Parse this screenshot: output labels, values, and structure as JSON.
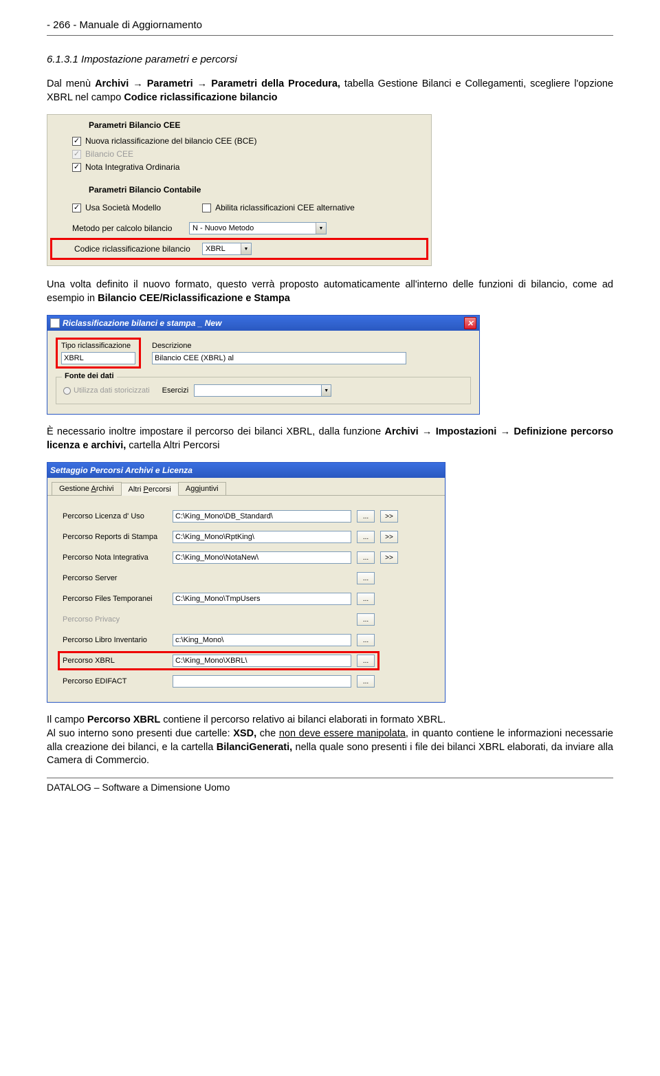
{
  "page_header": "- 266 -  Manuale di Aggiornamento",
  "section_number": "6.1.3.1  Impostazione parametri e percorsi",
  "para1_pre": "Dal menù ",
  "para1_b1": "Archivi",
  "para1_arr1": " → ",
  "para1_b2": "Parametri",
  "para1_arr2": " → ",
  "para1_b3": "Parametri della Procedura,",
  "para1_mid": " tabella Gestione Bilanci e Collegamenti, scegliere l'opzione XBRL nel campo ",
  "para1_b4": "Codice riclassificazione bilancio",
  "panel1": {
    "title1": "Parametri Bilancio CEE",
    "chk1": "Nuova riclassificazione del bilancio CEE (BCE)",
    "chk2": "Bilancio CEE",
    "chk3": "Nota Integrativa Ordinaria",
    "title2": "Parametri Bilancio Contabile",
    "chk4": "Usa Società Modello",
    "chk5": "Abilita riclassificazioni CEE alternative",
    "lbl_metodo": "Metodo per calcolo bilancio",
    "val_metodo": "N - Nuovo Metodo",
    "lbl_codice": "Codice riclassificazione bilancio",
    "val_codice": "XBRL"
  },
  "para2_pre": "Una volta definito il nuovo formato, questo verrà proposto automaticamente all'interno delle funzioni di bilancio, come ad esempio in ",
  "para2_b1": "Bilancio CEE/Riclassificazione e Stampa",
  "win1": {
    "title": "Riclassificazione bilanci e stampa _ New",
    "lbl_tipo": "Tipo riclassificazione",
    "val_tipo": "XBRL",
    "lbl_desc": "Descrizione",
    "val_desc": "Bilancio CEE (XBRL) al",
    "group_title": "Fonte dei dati",
    "radio1": "Utilizza dati storicizzati",
    "lbl_ese": "Esercizi"
  },
  "para3_pre": "È necessario inoltre impostare il percorso dei bilanci XBRL, dalla funzione ",
  "para3_b1": "Archivi",
  "para3_arr1": " → ",
  "para3_b2": "Impostazioni",
  "para3_arr2": " → ",
  "para3_b3": "Definizione percorso licenza e archivi,",
  "para3_post": " cartella Altri Percorsi",
  "win2": {
    "title": "Settaggio Percorsi Archivi e Licenza",
    "tab1a": "Gestione ",
    "tab1u": "A",
    "tab1b": "rchivi",
    "tab2a": "Altri ",
    "tab2u": "P",
    "tab2b": "ercorsi",
    "tab3a": "Agg",
    "tab3u": "i",
    "tab3b": "untivi",
    "rows": [
      {
        "label": "Percorso Licenza d' Uso",
        "value": "C:\\King_Mono\\DB_Standard\\",
        "btns": 2,
        "disabled": false,
        "hl": false,
        "hasInput": true
      },
      {
        "label": "Percorso Reports di Stampa",
        "value": "C:\\King_Mono\\RptKing\\",
        "btns": 2,
        "disabled": false,
        "hl": false,
        "hasInput": true
      },
      {
        "label": "Percorso Nota Integrativa",
        "value": "C:\\King_Mono\\NotaNew\\",
        "btns": 2,
        "disabled": false,
        "hl": false,
        "hasInput": true
      },
      {
        "label": "Percorso Server",
        "value": "",
        "btns": 1,
        "disabled": false,
        "hl": false,
        "hasInput": false
      },
      {
        "label": "Percorso Files Temporanei",
        "value": "C:\\King_Mono\\TmpUsers",
        "btns": 1,
        "disabled": false,
        "hl": false,
        "hasInput": true
      },
      {
        "label": "Percorso Privacy",
        "value": "",
        "btns": 1,
        "disabled": true,
        "hl": false,
        "hasInput": false
      },
      {
        "label": "Percorso Libro Inventario",
        "value": "c:\\King_Mono\\",
        "btns": 1,
        "disabled": false,
        "hl": false,
        "hasInput": true
      },
      {
        "label": "Percorso XBRL",
        "value": "C:\\King_Mono\\XBRL\\",
        "btns": 1,
        "disabled": false,
        "hl": true,
        "hasInput": true
      },
      {
        "label": "Percorso EDIFACT",
        "value": "",
        "btns": 1,
        "disabled": false,
        "hl": false,
        "hasInput": true
      }
    ],
    "btn_browse": "...",
    "btn_more": ">>"
  },
  "para4_a": "Il campo ",
  "para4_b1": "Percorso XBRL",
  "para4_b": "  contiene il percorso relativo ai bilanci elaborati in formato XBRL.",
  "para5_a": "Al suo interno sono presenti due cartelle: ",
  "para5_b1": "XSD,",
  "para5_b": " che ",
  "para5_u1": "non deve essere manipolata,",
  "para5_c": " in quanto contiene le informazioni necessarie alla creazione dei bilanci, e la cartella ",
  "para5_b2": "BilanciGenerati,",
  "para5_d": " nella quale sono presenti i file dei bilanci XBRL elaborati, da inviare alla Camera di Commercio.",
  "footer": "DATALOG – Software a Dimensione Uomo"
}
